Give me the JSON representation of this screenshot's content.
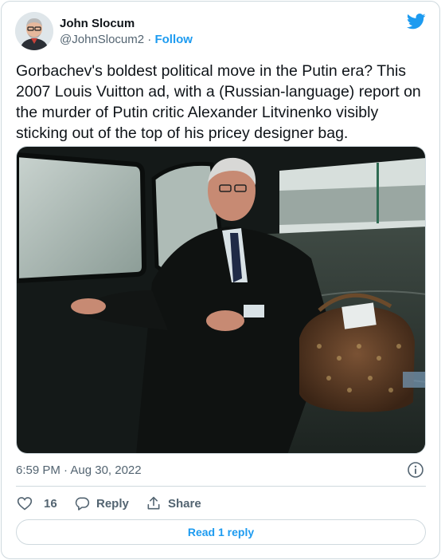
{
  "author": {
    "name": "John Slocum",
    "handle": "@JohnSlocum2",
    "separator": "·",
    "follow_label": "Follow"
  },
  "tweet": {
    "text": "Gorbachev's boldest political move in the Putin era? This 2007 Louis Vuitton ad, with a (Russian-language) report on the murder of Putin critic Alexander Litvinenko visibly sticking out of the top of his pricey designer bag.",
    "timestamp": "6:59 PM · Aug 30, 2022"
  },
  "actions": {
    "like_count": "16",
    "reply_label": "Reply",
    "share_label": "Share",
    "read_replies_label": "Read 1 reply"
  },
  "icons": {
    "brand": "twitter-bird-icon",
    "info": "info-icon",
    "like": "heart-icon",
    "reply": "speech-bubble-icon",
    "share": "share-upload-icon"
  },
  "colors": {
    "accent": "#1d9bf0",
    "text": "#0f1419",
    "secondary": "#536471",
    "border": "#cfd9de"
  }
}
